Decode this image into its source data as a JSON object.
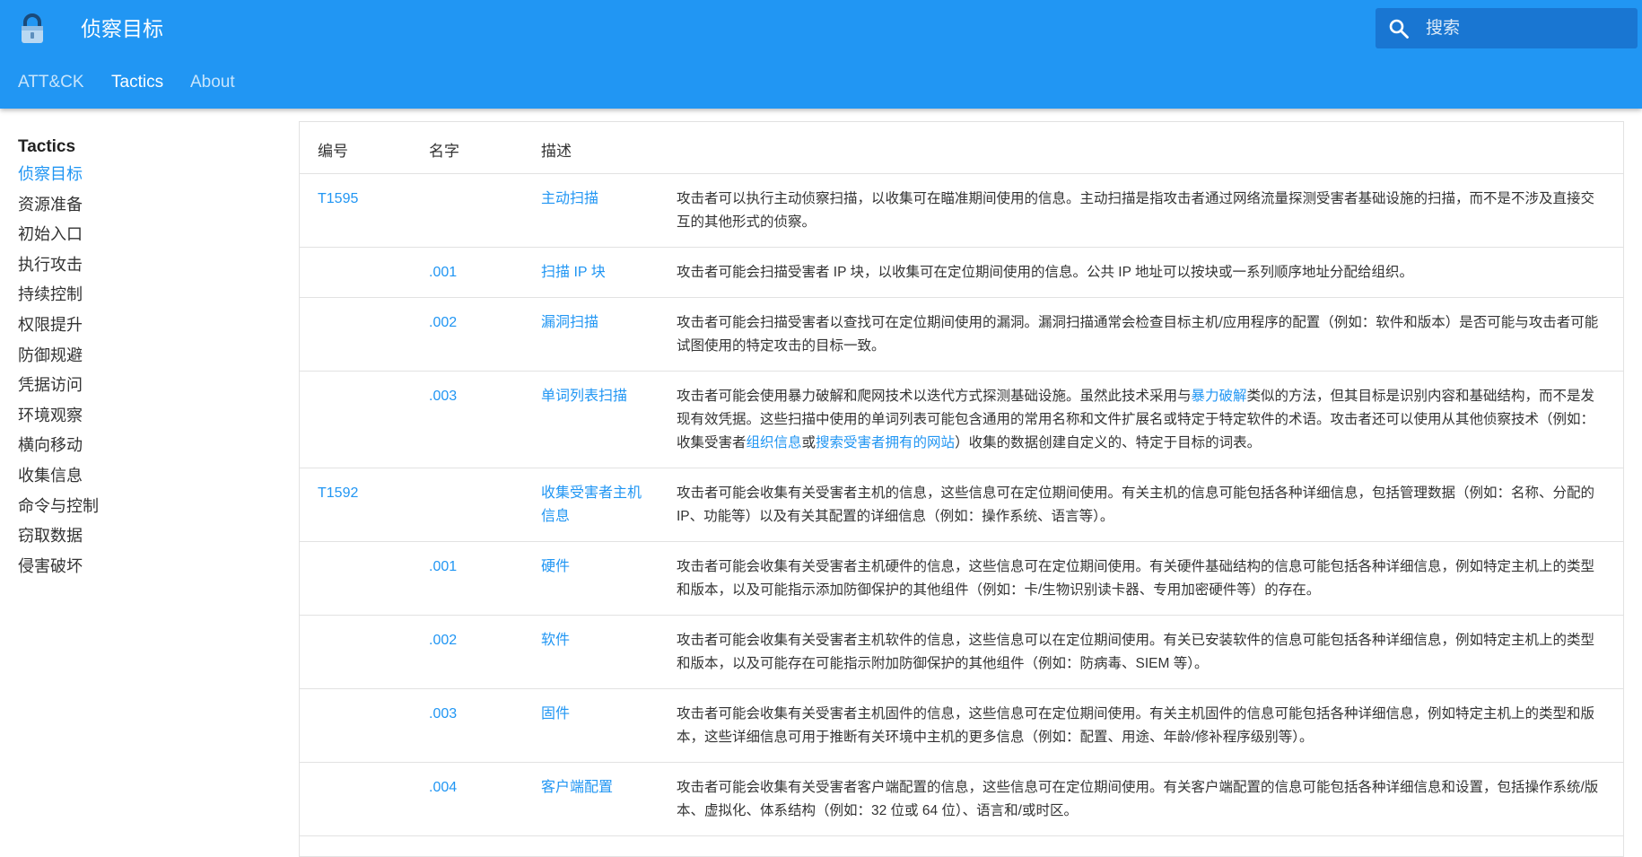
{
  "header": {
    "title": "侦察目标",
    "search_placeholder": "搜索"
  },
  "tabs": [
    {
      "label": "ATT&CK"
    },
    {
      "label": "Tactics"
    },
    {
      "label": "About"
    }
  ],
  "sidebar": {
    "title": "Tactics",
    "items": [
      "侦察目标",
      "资源准备",
      "初始入口",
      "执行攻击",
      "持续控制",
      "权限提升",
      "防御规避",
      "凭据访问",
      "环境观察",
      "横向移动",
      "收集信息",
      "命令与控制",
      "窃取数据",
      "侵害破坏"
    ]
  },
  "table": {
    "columns": [
      "编号",
      "名字",
      "描述"
    ],
    "rows": [
      {
        "id": "T1595",
        "sub": "",
        "name": "主动扫描",
        "desc": [
          {
            "t": "攻击者可以执行主动侦察扫描，以收集可在瞄准期间使用的信息。主动扫描是指攻击者通过网络流量探测受害者基础设施的扫描，而不是不涉及直接交互的其他形式的侦察。"
          }
        ]
      },
      {
        "id": "",
        "sub": ".001",
        "name": "扫描 IP 块",
        "desc": [
          {
            "t": "攻击者可能会扫描受害者 IP 块，以收集可在定位期间使用的信息。公共 IP 地址可以按块或一系列顺序地址分配给组织。"
          }
        ]
      },
      {
        "id": "",
        "sub": ".002",
        "name": "漏洞扫描",
        "desc": [
          {
            "t": "攻击者可能会扫描受害者以查找可在定位期间使用的漏洞。漏洞扫描通常会检查目标主机/应用程序的配置（例如：软件和版本）是否可能与攻击者可能试图使用的特定攻击的目标一致。"
          }
        ]
      },
      {
        "id": "",
        "sub": ".003",
        "name": "单词列表扫描",
        "desc": [
          {
            "t": "攻击者可能会使用暴力破解和爬网技术以迭代方式探测基础设施。虽然此技术采用与"
          },
          {
            "t": "暴力破解",
            "link": true
          },
          {
            "t": "类似的方法，但其目标是识别内容和基础结构，而不是发现有效凭据。这些扫描中使用的单词列表可能包含通用的常用名称和文件扩展名或特定于特定软件的术语。攻击者还可以使用从其他侦察技术（例如：收集受害者"
          },
          {
            "t": "组织信息",
            "link": true
          },
          {
            "t": "或"
          },
          {
            "t": "搜索受害者拥有的网站",
            "link": true
          },
          {
            "t": "）收集的数据创建自定义的、特定于目标的词表。"
          }
        ]
      },
      {
        "id": "T1592",
        "sub": "",
        "name": "收集受害者主机信息",
        "desc": [
          {
            "t": "攻击者可能会收集有关受害者主机的信息，这些信息可在定位期间使用。有关主机的信息可能包括各种详细信息，包括管理数据（例如：名称、分配的 IP、功能等）以及有关其配置的详细信息（例如：操作系统、语言等）。"
          }
        ]
      },
      {
        "id": "",
        "sub": ".001",
        "name": "硬件",
        "desc": [
          {
            "t": "攻击者可能会收集有关受害者主机硬件的信息，这些信息可在定位期间使用。有关硬件基础结构的信息可能包括各种详细信息，例如特定主机上的类型和版本，以及可能指示添加防御保护的其他组件（例如：卡/生物识别读卡器、专用加密硬件等）的存在。"
          }
        ]
      },
      {
        "id": "",
        "sub": ".002",
        "name": "软件",
        "desc": [
          {
            "t": "攻击者可能会收集有关受害者主机软件的信息，这些信息可以在定位期间使用。有关已安装软件的信息可能包括各种详细信息，例如特定主机上的类型和版本，以及可能存在可能指示附加防御保护的其他组件（例如：防病毒、SIEM 等）。"
          }
        ]
      },
      {
        "id": "",
        "sub": ".003",
        "name": "固件",
        "desc": [
          {
            "t": "攻击者可能会收集有关受害者主机固件的信息，这些信息可在定位期间使用。有关主机固件的信息可能包括各种详细信息，例如特定主机上的类型和版本，这些详细信息可用于推断有关环境中主机的更多信息（例如：配置、用途、年龄/修补程序级别等）。"
          }
        ]
      },
      {
        "id": "",
        "sub": ".004",
        "name": "客户端配置",
        "desc": [
          {
            "t": "攻击者可能会收集有关受害者客户端配置的信息，这些信息可在定位期间使用。有关客户端配置的信息可能包括各种详细信息和设置，包括操作系统/版本、虚拟化、体系结构（例如：32 位或 64 位）、语言和/或时区。"
          }
        ]
      }
    ]
  }
}
